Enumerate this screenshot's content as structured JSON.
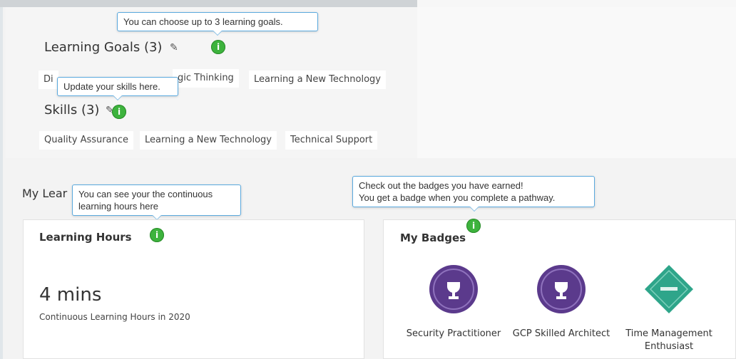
{
  "learning_goals": {
    "title": "Learning Goals (3)",
    "chips": [
      "Di",
      "gic Thinking",
      "Learning a New Technology"
    ],
    "tooltip": "You can choose up to 3 learning goals."
  },
  "skills": {
    "title": "Skills (3)",
    "chips": [
      "Quality Assurance",
      "Learning a New Technology",
      "Technical Support"
    ],
    "tooltip": "Update your skills here."
  },
  "my_learning": {
    "heading": "My Lear",
    "hours_tooltip_line1": "You can see your the continuous",
    "hours_tooltip_line2": "learning hours here"
  },
  "learning_hours": {
    "title": "Learning Hours",
    "value": "4 mins",
    "caption": "Continuous Learning Hours in 2020"
  },
  "badges": {
    "title": "My Badges",
    "tooltip_line1": "Check out the badges you have earned!",
    "tooltip_line2": "You get a badge when you complete a pathway.",
    "items": [
      {
        "line1": "Security Practitioner",
        "line2": "",
        "color": "#5b3a8c"
      },
      {
        "line1": "GCP Skilled Architect",
        "line2": "",
        "color": "#5b3a8c"
      },
      {
        "line1": "Time Management",
        "line2": "Enthusiast",
        "color": "#2ea58a"
      }
    ]
  },
  "info_glyph": "i",
  "icons": {
    "edit": "pencil-icon",
    "info": "info-icon"
  },
  "colors": {
    "info_green": "#3db33d",
    "tooltip_border": "#5aa9de",
    "badge_purple": "#5b3a8c",
    "badge_teal": "#2ea58a"
  }
}
